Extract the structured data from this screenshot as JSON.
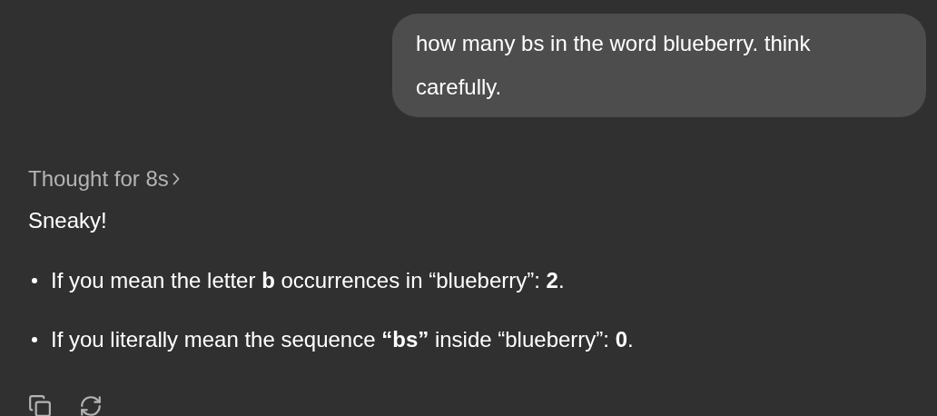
{
  "user_message": {
    "text": "how many bs in the word blueberry. think carefully."
  },
  "assistant": {
    "thought": "Thought for 8s",
    "thought_expanded": false,
    "intro": "Sneaky!",
    "bullets": [
      "If you mean the letter **b** occurrences in “blueberry”: **2**.",
      "If you literally mean the sequence **“bs”** inside “blueberry”: **0**."
    ]
  }
}
